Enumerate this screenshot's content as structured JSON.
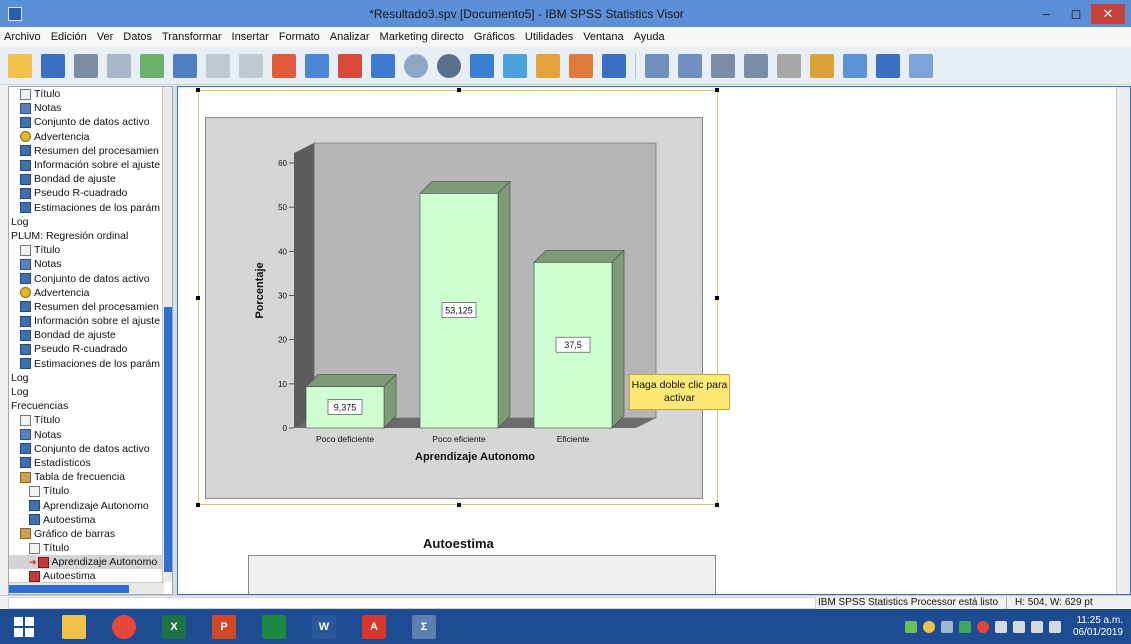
{
  "window": {
    "title": "*Resultado3.spv [Documento5] - IBM SPSS Statistics Visor",
    "minimize": "–",
    "maximize": "◻",
    "close": "✕"
  },
  "menu": [
    "Archivo",
    "Edición",
    "Ver",
    "Datos",
    "Transformar",
    "Insertar",
    "Formato",
    "Analizar",
    "Marketing directo",
    "Gráficos",
    "Utilidades",
    "Ventana",
    "Ayuda"
  ],
  "tree": [
    {
      "label": "Título",
      "icon": "head",
      "indent": 1
    },
    {
      "label": "Notas",
      "icon": "note",
      "indent": 1
    },
    {
      "label": "Conjunto de datos activo",
      "icon": "tbl",
      "indent": 1
    },
    {
      "label": "Advertencia",
      "icon": "warn",
      "indent": 1
    },
    {
      "label": "Resumen del procesamien",
      "icon": "tbl",
      "indent": 1
    },
    {
      "label": "Información sobre el ajuste",
      "icon": "tbl",
      "indent": 1
    },
    {
      "label": "Bondad de ajuste",
      "icon": "tbl",
      "indent": 1
    },
    {
      "label": "Pseudo R-cuadrado",
      "icon": "tbl",
      "indent": 1
    },
    {
      "label": "Estimaciones de los parám",
      "icon": "tbl",
      "indent": 1
    },
    {
      "label": "Log",
      "icon": "",
      "indent": 0
    },
    {
      "label": "PLUM: Regresión ordinal",
      "icon": "",
      "indent": 0
    },
    {
      "label": "Título",
      "icon": "head",
      "indent": 1
    },
    {
      "label": "Notas",
      "icon": "note",
      "indent": 1
    },
    {
      "label": "Conjunto de datos activo",
      "icon": "tbl",
      "indent": 1
    },
    {
      "label": "Advertencia",
      "icon": "warn",
      "indent": 1
    },
    {
      "label": "Resumen del procesamien",
      "icon": "tbl",
      "indent": 1
    },
    {
      "label": "Información sobre el ajuste",
      "icon": "tbl",
      "indent": 1
    },
    {
      "label": "Bondad de ajuste",
      "icon": "tbl",
      "indent": 1
    },
    {
      "label": "Pseudo R-cuadrado",
      "icon": "tbl",
      "indent": 1
    },
    {
      "label": "Estimaciones de los parám",
      "icon": "tbl",
      "indent": 1
    },
    {
      "label": "Log",
      "icon": "",
      "indent": 0
    },
    {
      "label": "Log",
      "icon": "",
      "indent": 0
    },
    {
      "label": "Frecuencias",
      "icon": "",
      "indent": 0
    },
    {
      "label": "Título",
      "icon": "head",
      "indent": 1
    },
    {
      "label": "Notas",
      "icon": "note",
      "indent": 1
    },
    {
      "label": "Conjunto de datos activo",
      "icon": "tbl",
      "indent": 1
    },
    {
      "label": "Estadísticos",
      "icon": "tbl",
      "indent": 1
    },
    {
      "label": "Tabla de frecuencia",
      "icon": "book",
      "indent": 1
    },
    {
      "label": "Título",
      "icon": "head",
      "indent": 2
    },
    {
      "label": "Aprendizaje Autonomo",
      "icon": "tbl",
      "indent": 2
    },
    {
      "label": "Autoestima",
      "icon": "tbl",
      "indent": 2
    },
    {
      "label": "Gráfico de barras",
      "icon": "book",
      "indent": 1
    },
    {
      "label": "Título",
      "icon": "head",
      "indent": 2
    },
    {
      "label": "Aprendizaje Autonomo",
      "icon": "chart",
      "indent": 2,
      "selected": true
    },
    {
      "label": "Autoestima",
      "icon": "chart",
      "indent": 2
    }
  ],
  "viewer": {
    "tooltip_line1": "Haga doble clic para",
    "tooltip_line2": "activar",
    "next_title": "Autoestima"
  },
  "chart_data": {
    "type": "bar",
    "categories": [
      "Poco deficiente",
      "Poco eficiente",
      "Eficiente"
    ],
    "values": [
      9.375,
      53.125,
      37.5
    ],
    "value_labels": [
      "9,375",
      "53,125",
      "37,5"
    ],
    "ylabel": "Porcentaje",
    "xlabel": "Aprendizaje Autonomo",
    "ylim": [
      0,
      60
    ],
    "yticks": [
      0,
      10,
      20,
      30,
      40,
      50,
      60
    ],
    "style": "3d",
    "bar_color": "#cfffd0",
    "bar_top_color": "#7e9a77",
    "floor_color": "#6b6b6b",
    "wall_color": "#b6b6b6"
  },
  "status": {
    "message": "IBM SPSS Statistics Processor está listo",
    "dims": "H: 504, W: 629 pt"
  },
  "clock": {
    "time": "11:25 a.m.",
    "date": "06/01/2019"
  }
}
